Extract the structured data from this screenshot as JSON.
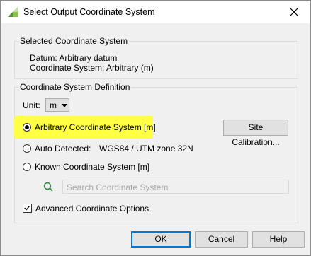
{
  "window": {
    "title": "Select Output Coordinate System"
  },
  "selected_group": {
    "label": "Selected Coordinate System",
    "datum": "Datum: Arbitrary datum",
    "coordinate_system": "Coordinate System: Arbitrary (m)"
  },
  "definition_group": {
    "label": "Coordinate System Definition",
    "unit_label": "Unit:",
    "unit_value": "m",
    "options": {
      "arbitrary": {
        "label": "Arbitrary Coordinate System [m]",
        "selected": true
      },
      "auto": {
        "label": "Auto Detected:",
        "value": "WGS84 / UTM zone 32N",
        "selected": false
      },
      "known": {
        "label": "Known Coordinate System [m]",
        "selected": false
      }
    },
    "site_calibration_label": "Site Calibration...",
    "search_placeholder": "Search Coordinate System",
    "advanced_label": "Advanced Coordinate Options",
    "advanced_checked": true
  },
  "buttons": {
    "ok": "OK",
    "cancel": "Cancel",
    "help": "Help"
  },
  "colors": {
    "highlight": "#ffff44",
    "accent": "#0078d7",
    "search_icon": "#2e8b3e"
  },
  "icons": {
    "app": "app-icon",
    "close": "close-icon",
    "search": "search-icon"
  }
}
